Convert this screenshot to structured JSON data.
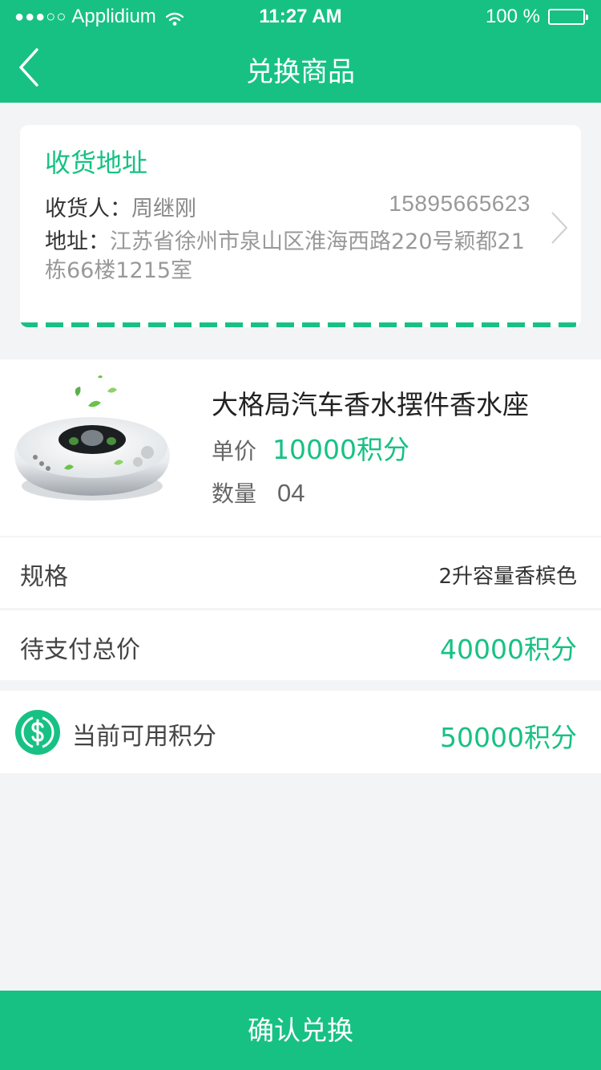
{
  "status_bar": {
    "signal_dots": "●●●○○",
    "carrier": "Applidium",
    "time": "11:27 AM",
    "battery": "100 %"
  },
  "nav": {
    "title": "兑换商品",
    "back_icon": "chevron-left-icon"
  },
  "address": {
    "heading": "收货地址",
    "receiver_label": "收货人：",
    "receiver_name": "周继刚",
    "phone": "15895665623",
    "address_label": "地址：",
    "address_text": "江苏省徐州市泉山区淮海西路220号颖都21栋66楼1215室"
  },
  "product": {
    "name": "大格局汽车香水摆件香水座",
    "price_label": "单价",
    "price_value": "10000积分",
    "quantity_label": "数量",
    "quantity_value": "04"
  },
  "spec": {
    "label": "规格",
    "value": "2升容量香槟色"
  },
  "total": {
    "label": "待支付总价",
    "value": "40000积分"
  },
  "points": {
    "icon": "dollar-coin-icon",
    "label": "当前可用积分",
    "value": "50000积分"
  },
  "confirm_button": "确认兑换",
  "colors": {
    "accent": "#17c184",
    "background": "#f3f4f6"
  }
}
